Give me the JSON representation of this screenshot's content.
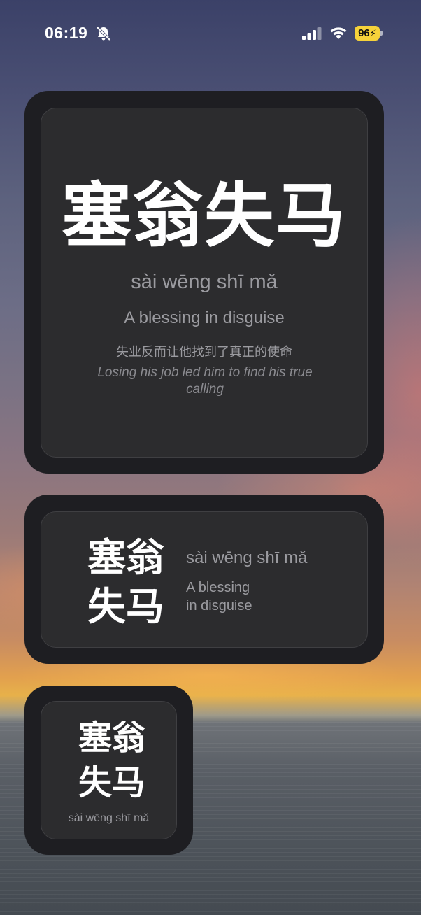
{
  "status_bar": {
    "time": "06:19",
    "battery": "96"
  },
  "phrase": {
    "hanzi": "塞翁失马",
    "hanzi_line1": "塞翁",
    "hanzi_line2": "失马",
    "pinyin": "sài wēng shī mǎ",
    "english": "A blessing in disguise",
    "english_line1": "A blessing",
    "english_line2": "in disguise",
    "example_zh": "失业反而让他找到了真正的使命",
    "example_en": "Losing his job led him to find his true calling"
  },
  "colors": {
    "widget_outer": "#1e1e22",
    "widget_inner": "#2c2c2e",
    "battery": "#f6d23a"
  },
  "icons": [
    "bell-slash-icon",
    "cellular-signal-icon",
    "wifi-icon",
    "battery-icon"
  ]
}
